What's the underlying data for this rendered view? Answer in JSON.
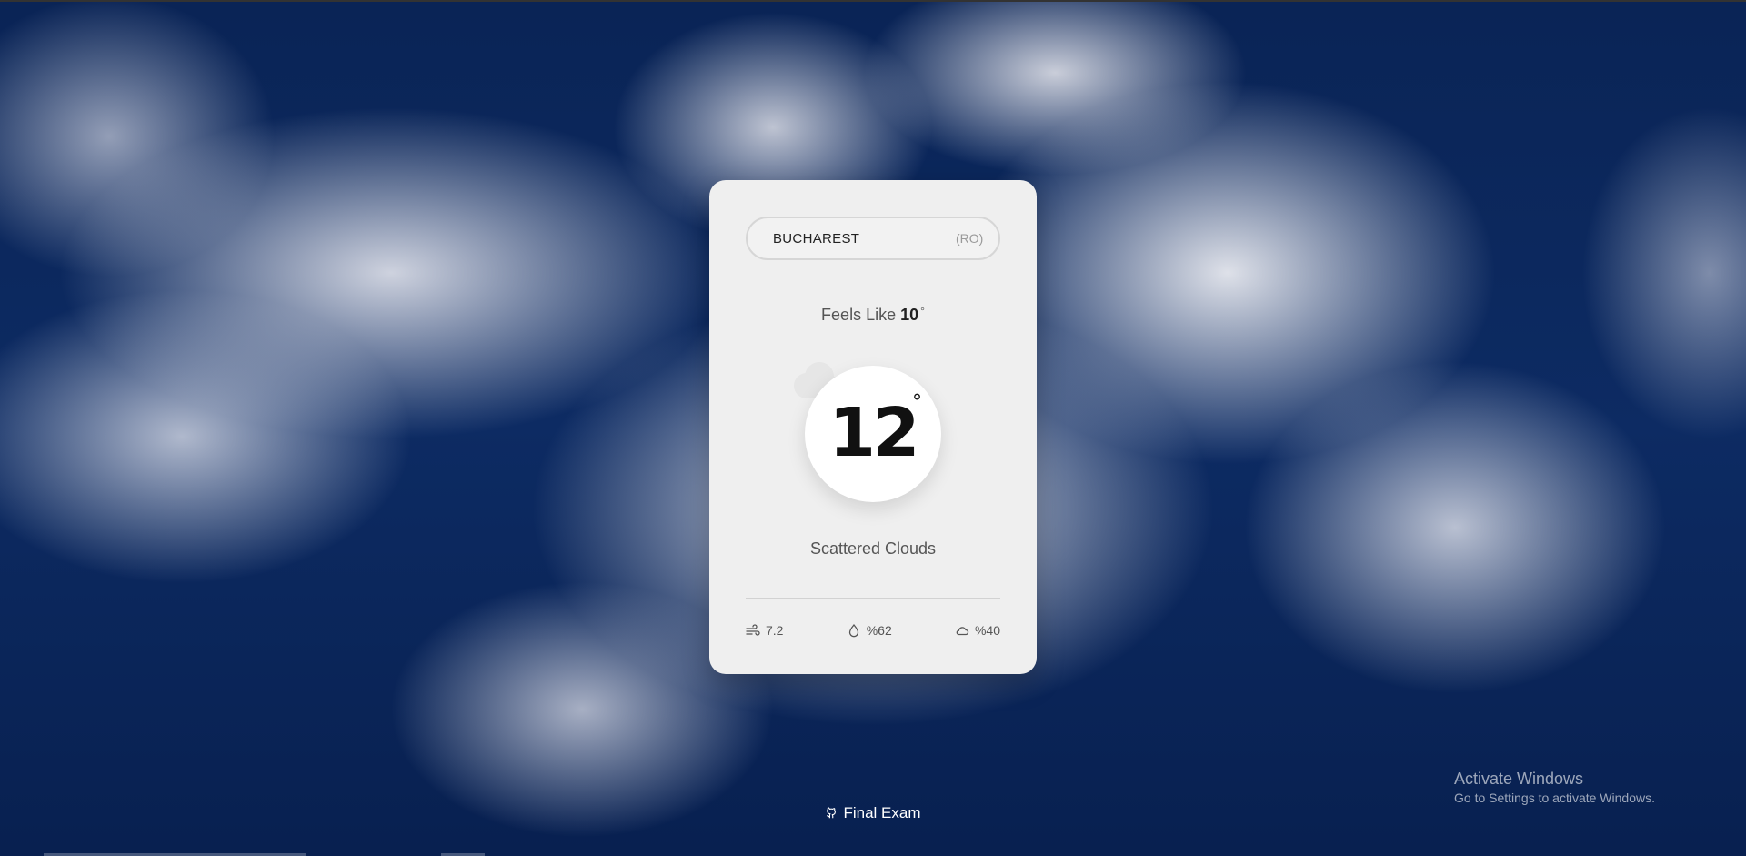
{
  "search": {
    "city": "BUCHAREST",
    "country": "(RO)"
  },
  "feels_like": {
    "label": "Feels Like",
    "value": "10",
    "unit": "°"
  },
  "temperature": {
    "value": "12",
    "unit": "°"
  },
  "description": "Scattered Clouds",
  "stats": {
    "wind": "7.2",
    "humidity": "%62",
    "clouds": "%40"
  },
  "footer": {
    "link_label": "Final Exam",
    "icon": "github-icon"
  },
  "watermark": {
    "title": "Activate Windows",
    "subtitle": "Go to Settings to activate Windows."
  },
  "colors": {
    "card_bg": "#efefef",
    "sky": "#0b2356"
  }
}
